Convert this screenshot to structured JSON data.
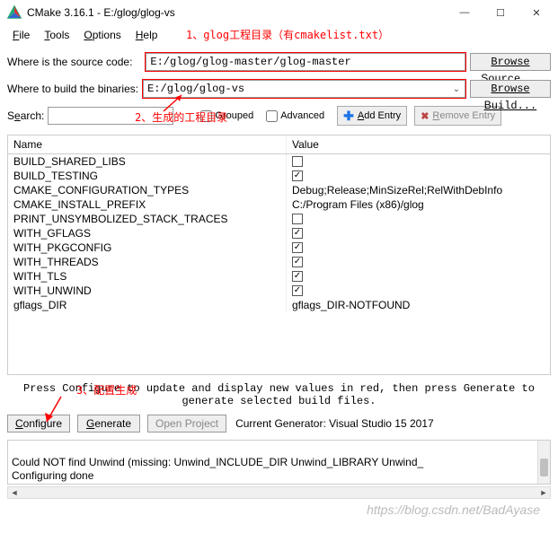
{
  "titlebar": {
    "title": "CMake 3.16.1 - E:/glog/glog-vs"
  },
  "menu": {
    "file": "File",
    "tools": "Tools",
    "options": "Options",
    "help": "Help"
  },
  "annotations": {
    "a1": "1、glog工程目录（有cmakelist.txt）",
    "a2": "2、生成的工程目录",
    "a3": "3、配置生成"
  },
  "source": {
    "label": "Where is the source code:   ",
    "value": "E:/glog/glog-master/glog-master",
    "browse": "Browse Source..."
  },
  "build": {
    "label": "Where to build the binaries:",
    "value": "E:/glog/glog-vs",
    "browse": "Browse Build..."
  },
  "search": {
    "label": "Search:",
    "grouped": "Grouped",
    "advanced": "Advanced",
    "addentry": "Add Entry",
    "removeentry": "Remove Entry"
  },
  "cache": {
    "headers": {
      "name": "Name",
      "value": "Value"
    },
    "rows": [
      {
        "name": "BUILD_SHARED_LIBS",
        "type": "check",
        "checked": false
      },
      {
        "name": "BUILD_TESTING",
        "type": "check",
        "checked": true
      },
      {
        "name": "CMAKE_CONFIGURATION_TYPES",
        "type": "text",
        "value": "Debug;Release;MinSizeRel;RelWithDebInfo"
      },
      {
        "name": "CMAKE_INSTALL_PREFIX",
        "type": "text",
        "value": "C:/Program Files (x86)/glog"
      },
      {
        "name": "PRINT_UNSYMBOLIZED_STACK_TRACES",
        "type": "check",
        "checked": false
      },
      {
        "name": "WITH_GFLAGS",
        "type": "check",
        "checked": true
      },
      {
        "name": "WITH_PKGCONFIG",
        "type": "check",
        "checked": true
      },
      {
        "name": "WITH_THREADS",
        "type": "check",
        "checked": true
      },
      {
        "name": "WITH_TLS",
        "type": "check",
        "checked": true
      },
      {
        "name": "WITH_UNWIND",
        "type": "check",
        "checked": true
      },
      {
        "name": "gflags_DIR",
        "type": "text",
        "value": "gflags_DIR-NOTFOUND"
      }
    ]
  },
  "helptext": "Press Configure to update and display new values in red, then press Generate to generate selected build files.",
  "buttons": {
    "configure": "Configure",
    "generate": "Generate",
    "openproject": "Open Project",
    "generator": "Current Generator: Visual Studio 15 2017"
  },
  "log": "\nCould NOT find Unwind (missing: Unwind_INCLUDE_DIR Unwind_LIBRARY Unwind_\nConfiguring done",
  "watermark": "https://blog.csdn.net/BadAyase"
}
